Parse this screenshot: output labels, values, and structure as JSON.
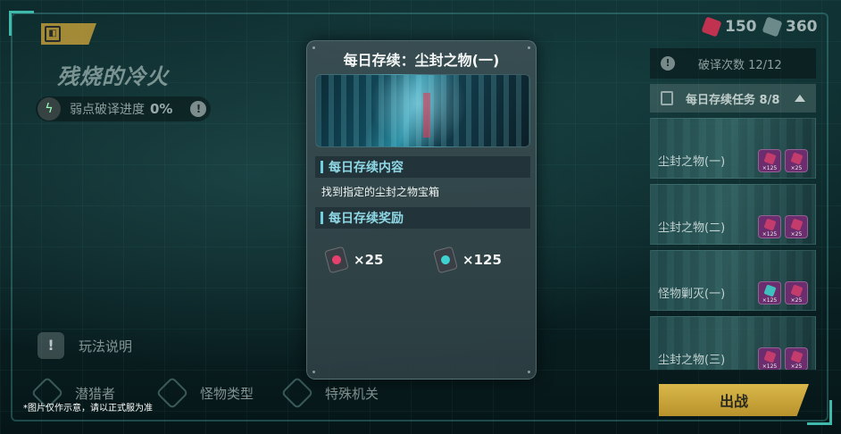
{
  "stage": {
    "title": "残烧的冷火",
    "weakness_label": "弱点破译进度",
    "weakness_value": "0%"
  },
  "currency": [
    {
      "icon": "red-crystal-icon",
      "value": "150",
      "color": "#c0324f"
    },
    {
      "icon": "teal-crystal-icon",
      "value": "360",
      "color": "#6c8a8a"
    }
  ],
  "left_panel": {
    "rules_label": "玩法说明"
  },
  "bottom_tabs": [
    {
      "icon": "hunter-icon",
      "label": "潜猎者"
    },
    {
      "icon": "monster-type-icon",
      "label": "怪物类型"
    },
    {
      "icon": "mechanism-icon",
      "label": "特殊机关"
    }
  ],
  "disclaimer": "*图片仅作示意，请以正式服为准",
  "popup": {
    "title": "每日存续：尘封之物(一)",
    "content_heading": "每日存续内容",
    "content_text": "找到指定的尘封之物宝箱",
    "reward_heading": "每日存续奖励",
    "rewards": [
      {
        "icon": "red-crystal-icon",
        "count": "×25",
        "color": "#e8406e"
      },
      {
        "icon": "teal-crystal-icon",
        "count": "×125",
        "color": "#3fd0cf"
      }
    ]
  },
  "right_panel": {
    "breakdown_label": "破译次数 12/12",
    "task_header": "每日存续任务 8/8",
    "tasks": [
      {
        "name": "尘封之物(一)",
        "rewards": [
          "×25",
          "×125"
        ]
      },
      {
        "name": "尘封之物(二)",
        "rewards": [
          "×25",
          "×125"
        ]
      },
      {
        "name": "怪物剿灭(一)",
        "rewards": [
          "×25",
          "×125"
        ]
      },
      {
        "name": "尘封之物(三)",
        "rewards": [
          "×25",
          "×125"
        ]
      }
    ]
  },
  "go_button": {
    "label": "出战"
  },
  "colors": {
    "accent_gold": "#c9a23a",
    "popup_heading": "#8fd8e6",
    "frame": "#3fb9ab"
  }
}
